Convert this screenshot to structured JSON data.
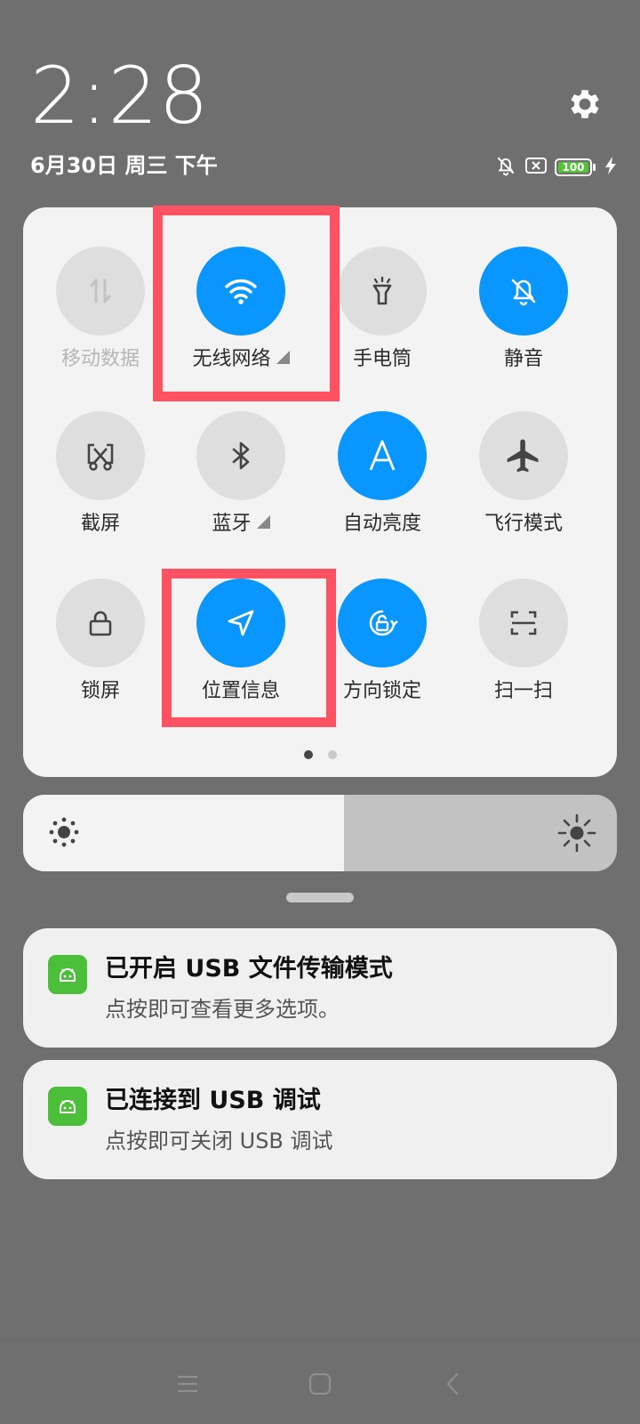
{
  "header": {
    "time": "2:28",
    "date": "6月30日 周三 下午",
    "battery_level": "100",
    "icons": [
      "settings-gear-icon",
      "notification-muted-icon",
      "sim-none-icon",
      "battery-icon",
      "charging-icon"
    ]
  },
  "quick_settings": {
    "tiles": [
      {
        "label": "移动数据",
        "icon": "mobile-data-icon",
        "state": "disabled"
      },
      {
        "label": "无线网络",
        "icon": "wifi-icon",
        "state": "on"
      },
      {
        "label": "手电筒",
        "icon": "flashlight-icon",
        "state": "off"
      },
      {
        "label": "静音",
        "icon": "silent-bell-icon",
        "state": "on"
      },
      {
        "label": "截屏",
        "icon": "screenshot-icon",
        "state": "off"
      },
      {
        "label": "蓝牙",
        "icon": "bluetooth-icon",
        "state": "off"
      },
      {
        "label": "自动亮度",
        "icon": "auto-brightness-icon",
        "state": "on"
      },
      {
        "label": "飞行模式",
        "icon": "airplane-icon",
        "state": "off"
      },
      {
        "label": "锁屏",
        "icon": "lock-icon",
        "state": "off"
      },
      {
        "label": "位置信息",
        "icon": "location-icon",
        "state": "on"
      },
      {
        "label": "方向锁定",
        "icon": "rotation-lock-icon",
        "state": "on"
      },
      {
        "label": "扫一扫",
        "icon": "scan-icon",
        "state": "off"
      }
    ],
    "page_count": 2,
    "active_page": 1
  },
  "brightness": {
    "level": 0.54
  },
  "notifications": [
    {
      "title": "已开启 USB 文件传输模式",
      "body": "点按即可查看更多选项。",
      "app_icon": "android-icon"
    },
    {
      "title": "已连接到 USB 调试",
      "body": "点按即可关闭 USB 调试",
      "app_icon": "android-icon"
    }
  ],
  "colors": {
    "accent": "#0a96ff",
    "highlight": "#fe5161",
    "android_green": "#4bbf3a"
  }
}
